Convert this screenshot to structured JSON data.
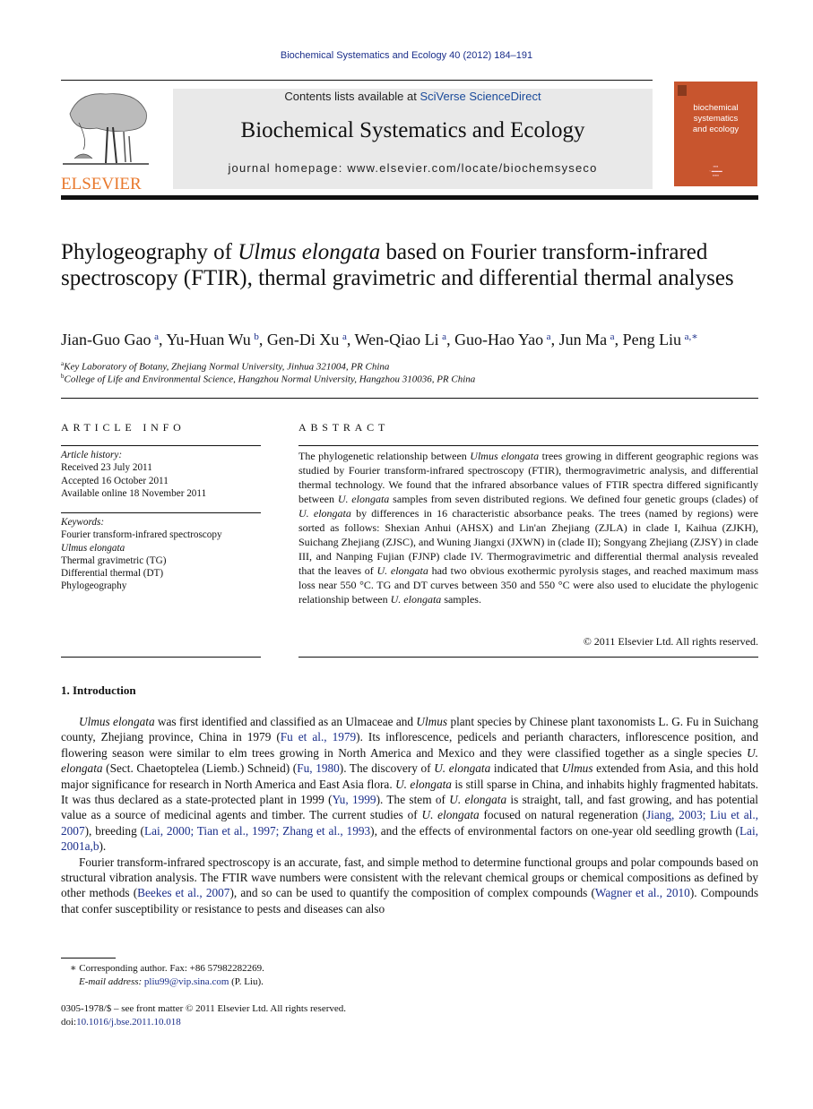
{
  "header": {
    "journal_ref": "Biochemical Systematics and Ecology 40 (2012) 184–191",
    "contents_prefix": "Contents lists available at ",
    "contents_link": "SciVerse ScienceDirect",
    "journal_title": "Biochemical Systematics and Ecology",
    "homepage": "journal homepage: www.elsevier.com/locate/biochemsyseco",
    "publisher_wordmark": "ELSEVIER",
    "cover_title_lines": [
      "biochemical",
      "systematics",
      "and ecology"
    ],
    "colors": {
      "elsevier_orange": "#e8782c",
      "cover_bg": "#c8552e",
      "link_blue": "#1a2e8a",
      "banner_gray": "#e9e9e9"
    }
  },
  "article": {
    "title_part1": "Phylogeography of ",
    "title_italic": "Ulmus elongata",
    "title_part2": " based on Fourier transform-infrared spectroscopy (FTIR), thermal gravimetric and differential thermal analyses",
    "authors": [
      {
        "name": "Jian-Guo Gao",
        "aff": "a"
      },
      {
        "name": "Yu-Huan Wu",
        "aff": "b"
      },
      {
        "name": "Gen-Di Xu",
        "aff": "a"
      },
      {
        "name": "Wen-Qiao Li",
        "aff": "a"
      },
      {
        "name": "Guo-Hao Yao",
        "aff": "a"
      },
      {
        "name": "Jun Ma",
        "aff": "a"
      },
      {
        "name": "Peng Liu",
        "aff": "a,∗"
      }
    ],
    "affiliations": [
      {
        "key": "a",
        "text": "Key Laboratory of Botany, Zhejiang Normal University, Jinhua 321004, PR China"
      },
      {
        "key": "b",
        "text": "College of Life and Environmental Science, Hangzhou Normal University, Hangzhou 310036, PR China"
      }
    ]
  },
  "article_info": {
    "heading": "ARTICLE INFO",
    "history_label": "Article history:",
    "history": [
      "Received 23 July 2011",
      "Accepted 16 October 2011",
      "Available online 18 November 2011"
    ],
    "keywords_label": "Keywords:",
    "keywords": [
      "Fourier transform-infrared spectroscopy",
      "Ulmus elongata",
      "Thermal gravimetric (TG)",
      "Differential thermal (DT)",
      "Phylogeography"
    ]
  },
  "abstract": {
    "heading": "ABSTRACT",
    "segments": [
      {
        "t": "The phylogenetic relationship between "
      },
      {
        "t": "Ulmus elongata",
        "i": true
      },
      {
        "t": " trees growing in different geographic regions was studied by Fourier transform-infrared spectroscopy (FTIR), thermogravimetric analysis, and differential thermal technology. We found that the infrared absorbance values of FTIR spectra differed significantly between "
      },
      {
        "t": "U. elongata",
        "i": true
      },
      {
        "t": " samples from seven distributed regions. We defined four genetic groups (clades) of "
      },
      {
        "t": "U. elongata",
        "i": true
      },
      {
        "t": " by differences in 16 characteristic absorbance peaks. The trees (named by regions) were sorted as follows: Shexian Anhui (AHSX) and Lin'an Zhejiang (ZJLA) in clade I, Kaihua (ZJKH), Suichang Zhejiang (ZJSC), and Wuning Jiangxi (JXWN) in (clade II); Songyang Zhejiang (ZJSY) in clade III, and Nanping Fujian (FJNP) clade IV. Thermogravimetric and differential thermal analysis revealed that the leaves of "
      },
      {
        "t": "U. elongata",
        "i": true
      },
      {
        "t": " had two obvious exothermic pyrolysis stages, and reached maximum mass loss near 550 °C. TG and DT curves between 350 and 550 °C were also used to elucidate the phylogenic relationship between "
      },
      {
        "t": "U. elongata",
        "i": true
      },
      {
        "t": " samples."
      }
    ],
    "copyright": "© 2011 Elsevier Ltd. All rights reserved."
  },
  "introduction": {
    "heading": "1.  Introduction",
    "paragraphs": [
      [
        {
          "t": "Ulmus elongata",
          "i": true
        },
        {
          "t": " was first identified and classified as an Ulmaceae and "
        },
        {
          "t": "Ulmus",
          "i": true
        },
        {
          "t": " plant species by Chinese plant taxonomists L. G. Fu in Suichang county, Zhejiang province, China in 1979 ("
        },
        {
          "t": "Fu et al., 1979",
          "l": true
        },
        {
          "t": "). Its inflorescence, pedicels and perianth characters, inflorescence position, and flowering season were similar to elm trees growing in North America and Mexico and they were classified together as a single species "
        },
        {
          "t": "U. elongata",
          "i": true
        },
        {
          "t": " (Sect. Chaetoptelea (Liemb.) Schneid) ("
        },
        {
          "t": "Fu, 1980",
          "l": true
        },
        {
          "t": "). The discovery of "
        },
        {
          "t": "U. elongata",
          "i": true
        },
        {
          "t": " indicated that "
        },
        {
          "t": "Ulmus",
          "i": true
        },
        {
          "t": " extended from Asia, and this hold major significance for research in North America and East Asia flora. "
        },
        {
          "t": "U. elongata",
          "i": true
        },
        {
          "t": " is still sparse in China, and inhabits highly fragmented habitats. It was thus declared as a state-protected plant in 1999 ("
        },
        {
          "t": "Yu, 1999",
          "l": true
        },
        {
          "t": "). The stem of "
        },
        {
          "t": "U. elongata",
          "i": true
        },
        {
          "t": " is straight, tall, and fast growing, and has potential value as a source of medicinal agents and timber. The current studies of "
        },
        {
          "t": "U. elongata",
          "i": true
        },
        {
          "t": " focused on natural regeneration ("
        },
        {
          "t": "Jiang, 2003; Liu et al., 2007",
          "l": true
        },
        {
          "t": "), breeding ("
        },
        {
          "t": "Lai, 2000; Tian et al., 1997; Zhang et al., 1993",
          "l": true
        },
        {
          "t": "), and the effects of environmental factors on one-year old seedling growth ("
        },
        {
          "t": "Lai, 2001a,b",
          "l": true
        },
        {
          "t": ")."
        }
      ],
      [
        {
          "t": "Fourier transform-infrared spectroscopy is an accurate, fast, and simple method to determine functional groups and polar compounds based on structural vibration analysis. The FTIR wave numbers were consistent with the relevant chemical groups or chemical compositions as defined by other methods ("
        },
        {
          "t": "Beekes et al., 2007",
          "l": true
        },
        {
          "t": "), and so can be used to quantify the composition of complex compounds ("
        },
        {
          "t": "Wagner et al., 2010",
          "l": true
        },
        {
          "t": "). Compounds that confer susceptibility or resistance to pests and diseases can also"
        }
      ]
    ]
  },
  "footnotes": {
    "corresponding": "∗  Corresponding author. Fax: +86 57982282269.",
    "email_label": "E-mail address: ",
    "email": "pliu99@vip.sina.com",
    "email_suffix": " (P. Liu).",
    "front_matter": "0305-1978/$ – see front matter © 2011 Elsevier Ltd. All rights reserved.",
    "doi_label": "doi:",
    "doi": "10.1016/j.bse.2011.10.018"
  }
}
